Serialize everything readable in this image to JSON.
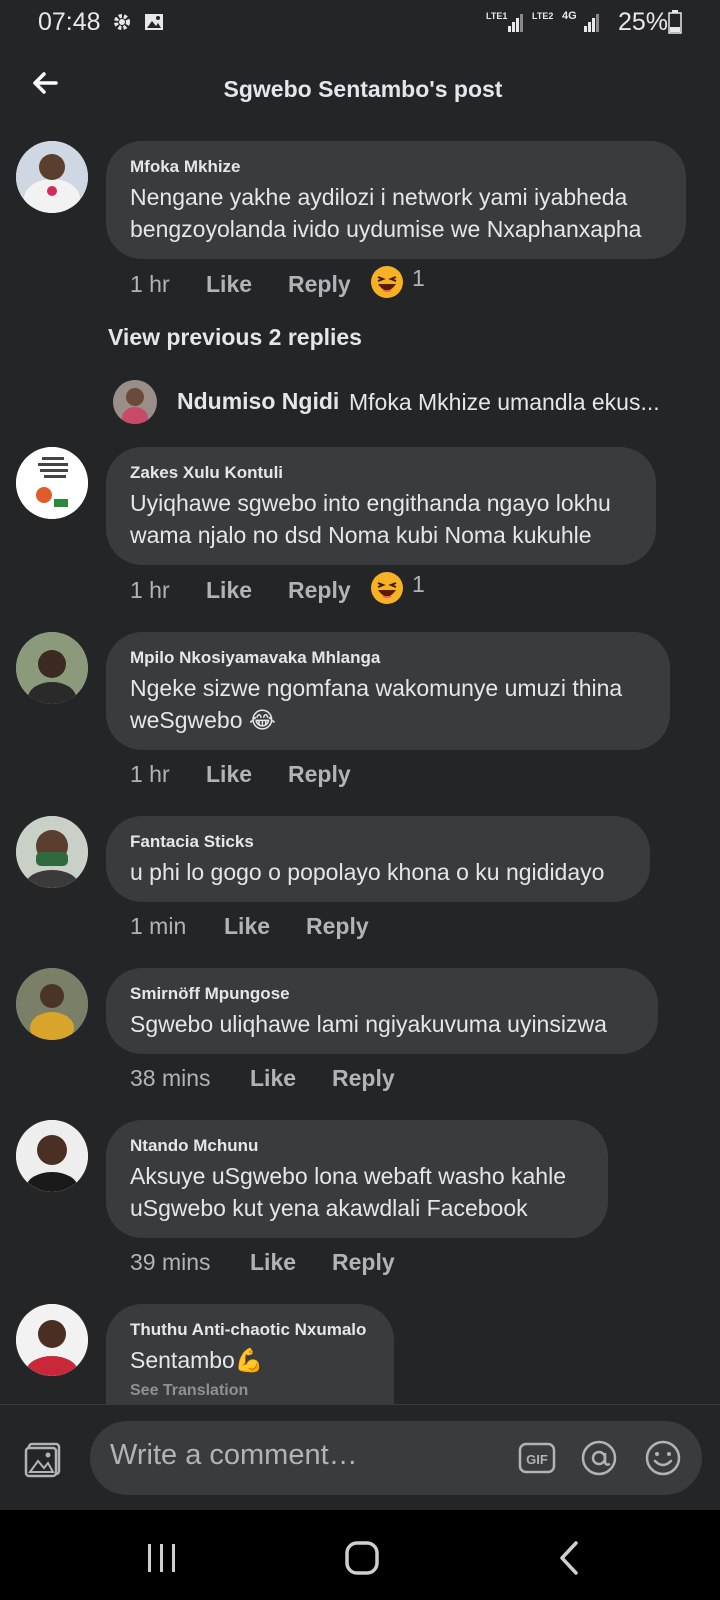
{
  "status_bar": {
    "time": "07:48",
    "sim1": "LTE1",
    "sim2": "LTE2",
    "network": "4G",
    "battery": "25%"
  },
  "header": {
    "title": "Sgwebo Sentambo's post"
  },
  "comments": [
    {
      "author": "Mfoka Mkhize",
      "text": "Nengane yakhe aydilozi i network yami iyabheda bengzoyolanda ivido uydumise we Nxaphanxapha",
      "time": "1 hr",
      "like": "Like",
      "reply": "Reply",
      "reaction_count": "1"
    },
    {
      "author": "Zakes Xulu Kontuli",
      "text": "Uyiqhawe sgwebo into engithanda ngayo lokhu wama njalo no dsd Noma kubi Noma kukuhle",
      "time": "1 hr",
      "like": "Like",
      "reply": "Reply",
      "reaction_count": "1"
    },
    {
      "author": "Mpilo Nkosiyamavaka Mhlanga",
      "text": "Ngeke sizwe ngomfana wakomunye umuzi thina weSgwebo 😂",
      "time": "1 hr",
      "like": "Like",
      "reply": "Reply"
    },
    {
      "author": "Fantacia Sticks",
      "text": "u phi lo gogo o popolayo khona o ku ngididayo",
      "time": "1 min",
      "like": "Like",
      "reply": "Reply"
    },
    {
      "author": "Smirnöff Mpungose",
      "text": "Sgwebo uliqhawe lami ngiyakuvuma  uyinsizwa",
      "time": "38 mins",
      "like": "Like",
      "reply": "Reply"
    },
    {
      "author": "Ntando Mchunu",
      "text": "Aksuye uSgwebo lona webaft washo kahle uSgwebo kut yena akawdlali Facebook",
      "time": "39 mins",
      "like": "Like",
      "reply": "Reply"
    },
    {
      "author": "Thuthu Anti-chaotic Nxumalo",
      "text": "Sentambo💪",
      "see_translation": "See Translation"
    }
  ],
  "replies_thread": {
    "view_previous": "View previous 2 replies",
    "reply_author": "Ndumiso Ngidi",
    "reply_snippet": "Mfoka Mkhize umandla ekus..."
  },
  "composer": {
    "placeholder": "Write a comment…",
    "gif_label": "GIF"
  },
  "colors": {
    "background": "#242527",
    "bubble": "#3a3b3c",
    "primary_text": "#e4e6eb",
    "secondary_text": "#b0b3b8",
    "reaction": "#f7b125"
  },
  "icons": {
    "back": "arrow-left-icon",
    "reaction": "laughing-emoji-icon",
    "photo": "photo-icon",
    "gif": "gif-icon",
    "mention": "at-icon",
    "emoji": "smiley-icon"
  }
}
